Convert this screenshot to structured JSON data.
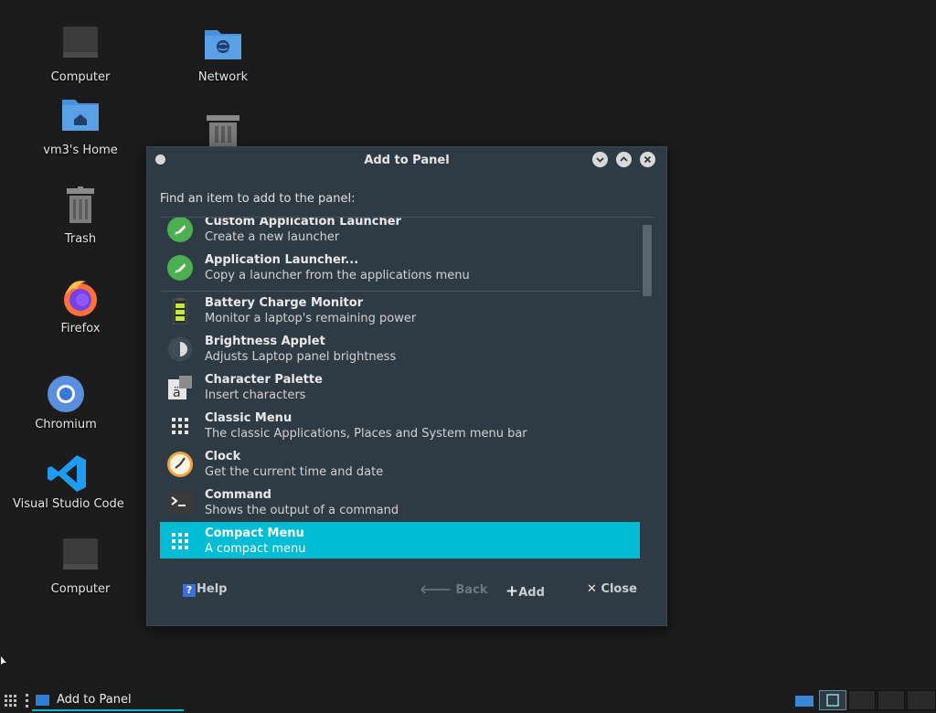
{
  "desktop": {
    "icons": [
      {
        "label": "Computer"
      },
      {
        "label": "Network"
      },
      {
        "label": "vm3's Home"
      },
      {
        "label": "Trash"
      },
      {
        "label": "Firefox"
      },
      {
        "label": "Chromium"
      },
      {
        "label": "Visual Studio Code"
      },
      {
        "label": "Computer"
      }
    ]
  },
  "dialog": {
    "title": "Add to Panel",
    "find_label": "Find an item to add to the panel:",
    "items": [
      {
        "name": "Custom Application Launcher",
        "desc": "Create a new launcher",
        "icon": "rocket-icon"
      },
      {
        "name": "Application Launcher...",
        "desc": "Copy a launcher from the applications menu",
        "icon": "rocket-icon"
      },
      {
        "name": "Battery Charge Monitor",
        "desc": "Monitor a laptop's remaining power",
        "icon": "battery-icon"
      },
      {
        "name": "Brightness Applet",
        "desc": "Adjusts Laptop panel brightness",
        "icon": "brightness-icon"
      },
      {
        "name": "Character Palette",
        "desc": "Insert characters",
        "icon": "character-palette-icon"
      },
      {
        "name": "Classic Menu",
        "desc": "The classic Applications, Places and System menu bar",
        "icon": "grid-menu-icon"
      },
      {
        "name": "Clock",
        "desc": "Get the current time and date",
        "icon": "clock-icon"
      },
      {
        "name": "Command",
        "desc": "Shows the output of a command",
        "icon": "terminal-icon"
      },
      {
        "name": "Compact Menu",
        "desc": "A compact menu",
        "icon": "grid-menu-icon"
      }
    ],
    "selected_index": 8,
    "buttons": {
      "help": "Help",
      "back": "Back",
      "add": "Add",
      "close": "Close"
    },
    "accent_color": "#00bcd4"
  },
  "taskbar": {
    "window_title": "Add to Panel"
  }
}
